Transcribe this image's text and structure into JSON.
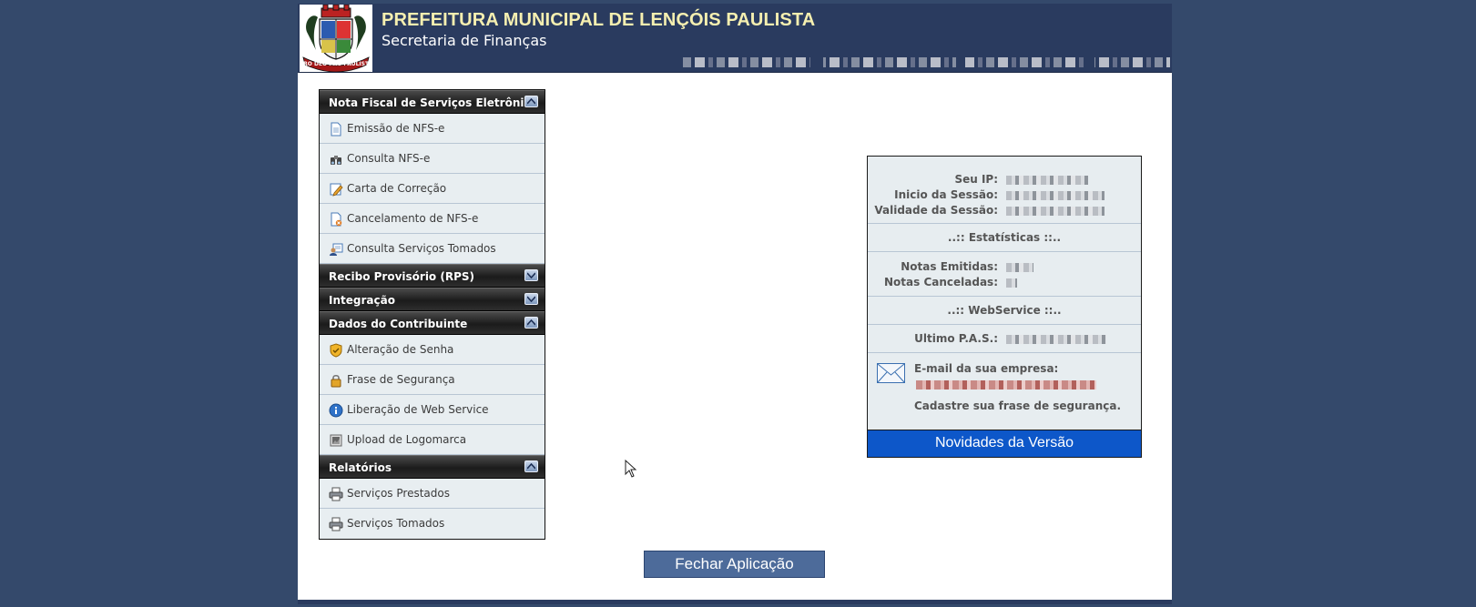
{
  "header": {
    "title": "PREFEITURA MUNICIPAL DE LENÇÓIS PAULISTA",
    "subtitle": "Secretaria de Finanças",
    "crest_motto": "PRO DEO PRO PAULISTA"
  },
  "menu": {
    "sections": [
      {
        "label": "Nota Fiscal de Serviços Eletrônica",
        "expanded": true,
        "items": [
          {
            "label": "Emissão de NFS-e",
            "icon": "document-icon"
          },
          {
            "label": "Consulta NFS-e",
            "icon": "binoculars-icon"
          },
          {
            "label": "Carta de Correção",
            "icon": "edit-pencil-icon"
          },
          {
            "label": "Cancelamento de NFS-e",
            "icon": "document-cancel-icon"
          },
          {
            "label": "Consulta Serviços Tomados",
            "icon": "user-card-icon"
          }
        ]
      },
      {
        "label": "Recibo Provisório (RPS)",
        "expanded": false,
        "items": []
      },
      {
        "label": "Integração",
        "expanded": false,
        "items": []
      },
      {
        "label": "Dados do Contribuinte",
        "expanded": true,
        "items": [
          {
            "label": "Alteração de Senha",
            "icon": "shield-icon"
          },
          {
            "label": "Frase de Segurança",
            "icon": "lock-icon"
          },
          {
            "label": "Liberação de Web Service",
            "icon": "info-icon"
          },
          {
            "label": "Upload de Logomarca",
            "icon": "image-icon"
          }
        ]
      },
      {
        "label": "Relatórios",
        "expanded": true,
        "items": [
          {
            "label": "Serviços Prestados",
            "icon": "printer-icon"
          },
          {
            "label": "Serviços Tomados",
            "icon": "printer-icon"
          }
        ]
      }
    ]
  },
  "info": {
    "ip_label": "Seu IP:",
    "session_start_label": "Inicio da Sessão:",
    "session_valid_label": "Validade da Sessão:",
    "stats_title": "..:: Estatísticas ::..",
    "notes_issued_label": "Notas Emitidas:",
    "notes_canceled_label": "Notas Canceladas:",
    "webservice_title": "..:: WebService ::..",
    "last_pas_label": "Ultimo P.A.S.:",
    "email_label": "E-mail da sua empresa:",
    "security_phrase_msg": "Cadastre sua frase de segurança.",
    "news_button": "Novidades da Versão"
  },
  "footer": {
    "close_button": "Fechar Aplicação"
  },
  "colors": {
    "page_bg": "#34496b",
    "header_bg": "#2a3b5f",
    "title_color": "#f5efb0",
    "menu_item_bg": "#e8eef1",
    "news_button_bg": "#0d57c9",
    "close_button_bg": "#4d6b9a"
  }
}
